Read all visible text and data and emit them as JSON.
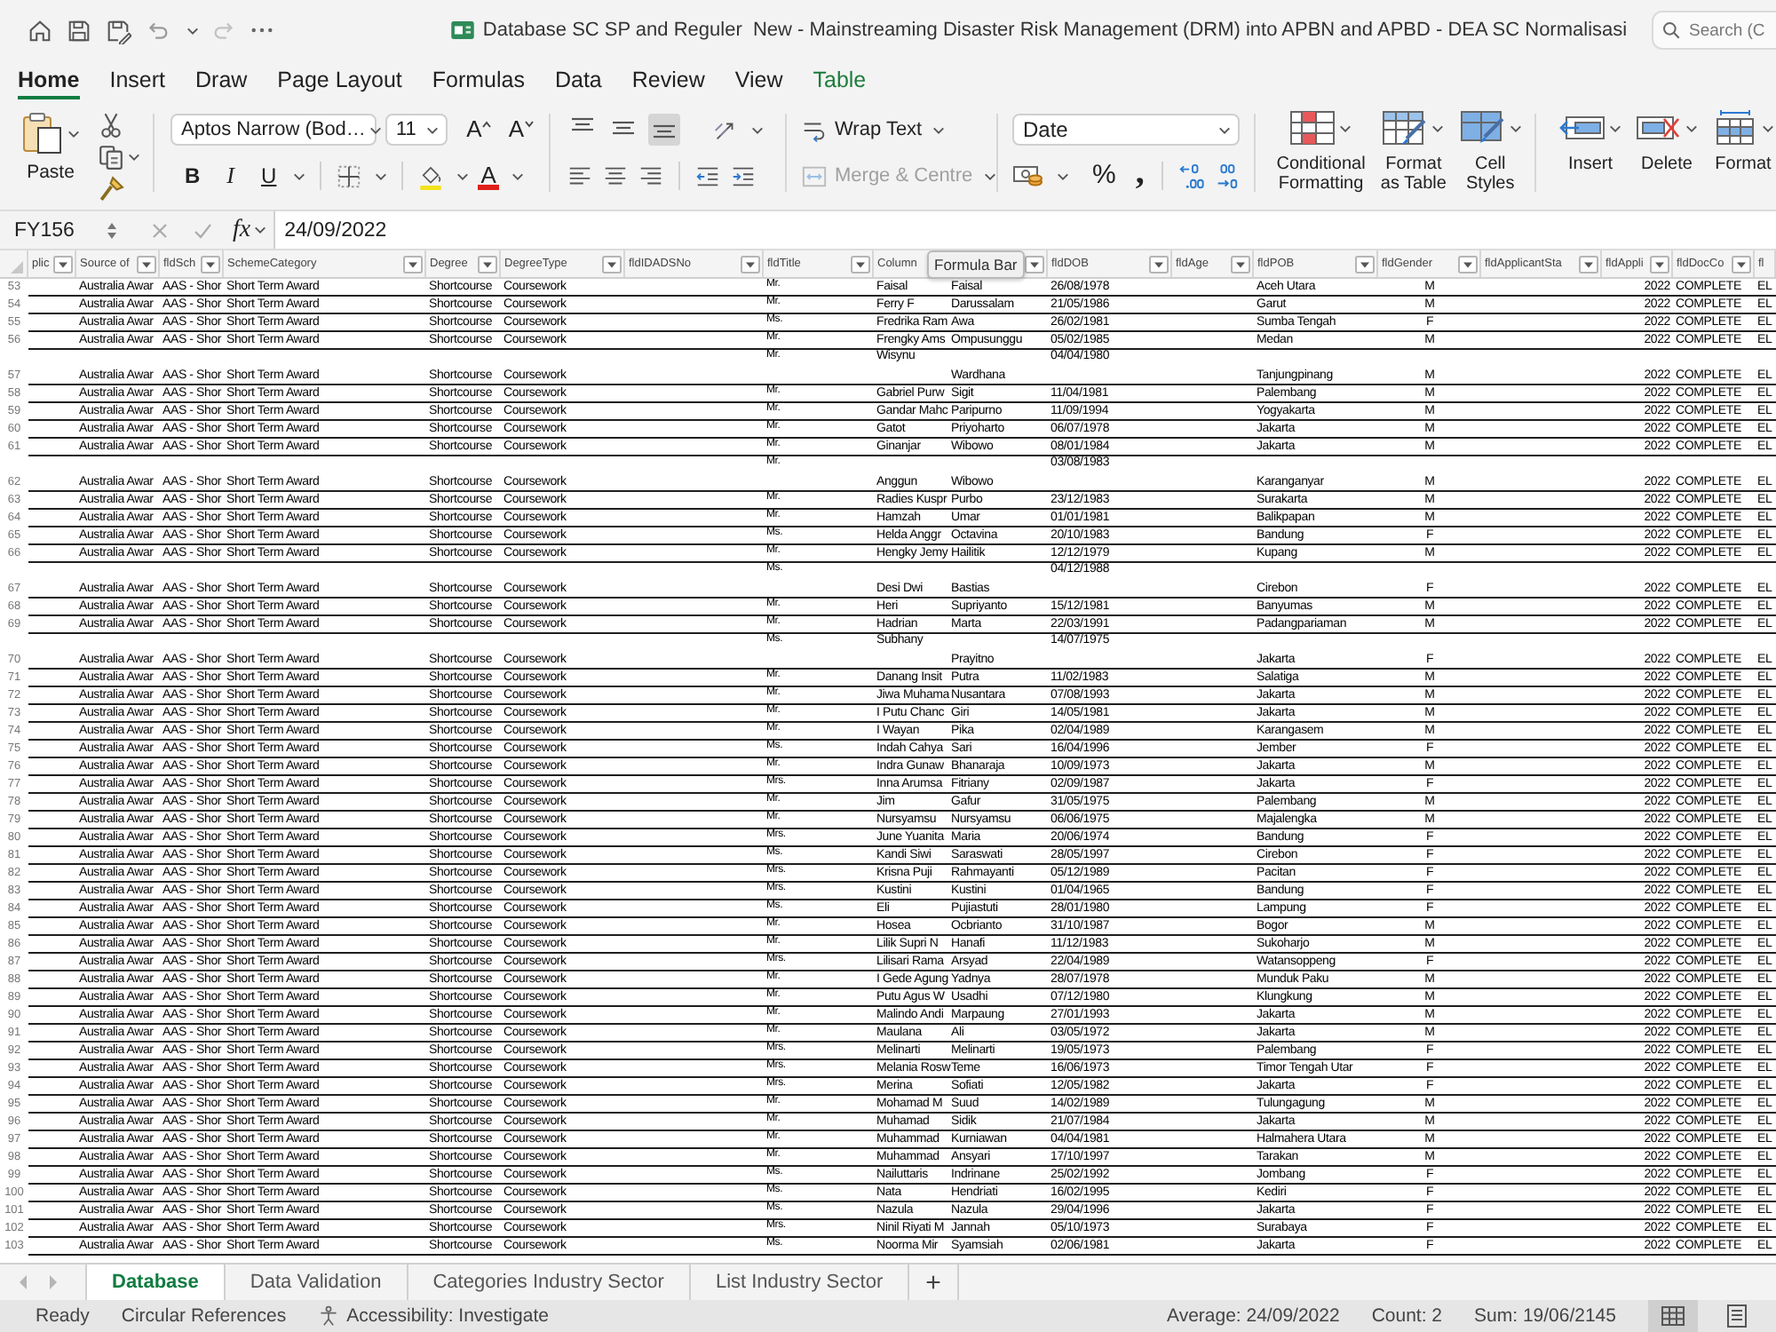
{
  "title_bar": {
    "title": "Database SC SP and Reguler  New - Mainstreaming Disaster Risk Management (DRM) into APBN and APBD - DEA SC Normalisasi",
    "search": {
      "placeholder": "Search (C"
    }
  },
  "ribbon_tabs": [
    {
      "label": "Home",
      "selected": true,
      "contextual": false
    },
    {
      "label": "Insert",
      "selected": false,
      "contextual": false
    },
    {
      "label": "Draw",
      "selected": false,
      "contextual": false
    },
    {
      "label": "Page Layout",
      "selected": false,
      "contextual": false
    },
    {
      "label": "Formulas",
      "selected": false,
      "contextual": false
    },
    {
      "label": "Data",
      "selected": false,
      "contextual": false
    },
    {
      "label": "Review",
      "selected": false,
      "contextual": false
    },
    {
      "label": "View",
      "selected": false,
      "contextual": false
    },
    {
      "label": "Table",
      "selected": false,
      "contextual": true
    }
  ],
  "ribbon": {
    "paste": "Paste",
    "font": {
      "name": "Aptos Narrow (Bod…",
      "size": "11",
      "grow": "A",
      "shrink": "A",
      "bold": "B",
      "italic": "I",
      "underline": "U",
      "font_color": "A"
    },
    "vertical_align": [
      {
        "kind": "top",
        "selected": false
      },
      {
        "kind": "middle",
        "selected": false
      },
      {
        "kind": "bottom",
        "selected": true
      }
    ],
    "wrap_text": "Wrap Text",
    "merge": {
      "label": "Merge & Centre",
      "disabled": true
    },
    "number_format": "Date",
    "percent": "%",
    "comma": ",",
    "styles": [
      "Conditional Formatting",
      "Format as Table",
      "Cell Styles"
    ],
    "cells": [
      "Insert",
      "Delete",
      "Format"
    ]
  },
  "formula_bar": {
    "name_box": "FY156",
    "function_button": "fx",
    "formula": "24/09/2022",
    "tooltip": "Formula Bar"
  },
  "table": {
    "columns": [
      {
        "header": "plic",
        "filter": true
      },
      {
        "header": "Source of",
        "filter": true
      },
      {
        "header": "fldSch",
        "filter": true
      },
      {
        "header": "SchemeCategory",
        "filter": true
      },
      {
        "header": "Degree",
        "filter": true
      },
      {
        "header": "DegreeType",
        "filter": true
      },
      {
        "header": "fldIDADSNo",
        "filter": true
      },
      {
        "header": "fldTitle",
        "filter": true
      },
      {
        "header": "Column",
        "filter": false
      },
      {
        "filter": true
      },
      {
        "header": "fldDOB",
        "filter": true
      },
      {
        "header": "fldAge",
        "filter": true
      },
      {
        "header": "fldPOB",
        "filter": true
      },
      {
        "header": "fldGender",
        "filter": true
      },
      {
        "header": "fldApplicantSta",
        "filter": true
      },
      {
        "header": "fldAppli",
        "filter": true
      },
      {
        "header": "fldDocCo",
        "filter": true
      },
      {
        "header": "fl",
        "filter": false
      }
    ],
    "rows": [
      {
        "number": "53",
        "kind": "single",
        "cells": [
          null,
          "Australia Awar",
          "AAS - Shor",
          "Short Term Award",
          "Shortcourse",
          "Coursework",
          null,
          "Mr.",
          "Faisal",
          "Faisal",
          "26/08/1978",
          null,
          "Aceh Utara",
          "M",
          null,
          "2022",
          "COMPLETE",
          "EL"
        ]
      },
      {
        "number": "54",
        "kind": "single",
        "cells": [
          null,
          "Australia Awar",
          "AAS - Shor",
          "Short Term Award",
          "Shortcourse",
          "Coursework",
          null,
          "Mr.",
          "Ferry F",
          "Darussalam",
          "21/05/1986",
          null,
          "Garut",
          "M",
          null,
          "2022",
          "COMPLETE",
          "EL"
        ]
      },
      {
        "number": "55",
        "kind": "single",
        "cells": [
          null,
          "Australia Awar",
          "AAS - Shor",
          "Short Term Award",
          "Shortcourse",
          "Coursework",
          null,
          "Ms.",
          "Fredrika Ram",
          "Awa",
          "26/02/1981",
          null,
          "Sumba Tengah",
          "F",
          null,
          "2022",
          "COMPLETE",
          "EL"
        ]
      },
      {
        "number": "56",
        "kind": "single",
        "cells": [
          null,
          "Australia Awar",
          "AAS - Shor",
          "Short Term Award",
          "Shortcourse",
          "Coursework",
          null,
          "Mr.",
          "Frengky Ams",
          "Ompusunggu",
          "05/02/1985",
          null,
          "Medan",
          "M",
          null,
          "2022",
          "COMPLETE",
          "EL"
        ]
      },
      {
        "number": "57",
        "kind": "name-top",
        "cells": [
          null,
          "Australia Awar",
          "AAS - Shor",
          "Short Term Award",
          "Shortcourse",
          "Coursework",
          null,
          "Mr.",
          "Wisynu",
          "Wardhana",
          "04/04/1980",
          null,
          "Tanjungpinang",
          "M",
          null,
          "2022",
          "COMPLETE",
          "EL"
        ]
      },
      {
        "number": "58",
        "kind": "single",
        "cells": [
          null,
          "Australia Awar",
          "AAS - Shor",
          "Short Term Award",
          "Shortcourse",
          "Coursework",
          null,
          "Mr.",
          "Gabriel Purw",
          "Sigit",
          "11/04/1981",
          null,
          "Palembang",
          "M",
          null,
          "2022",
          "COMPLETE",
          "EL"
        ]
      },
      {
        "number": "59",
        "kind": "single",
        "cells": [
          null,
          "Australia Awar",
          "AAS - Shor",
          "Short Term Award",
          "Shortcourse",
          "Coursework",
          null,
          "Mr.",
          "Gandar Mahc",
          "Paripurno",
          "11/09/1994",
          null,
          "Yogyakarta",
          "M",
          null,
          "2022",
          "COMPLETE",
          "EL"
        ]
      },
      {
        "number": "60",
        "kind": "single",
        "cells": [
          null,
          "Australia Awar",
          "AAS - Shor",
          "Short Term Award",
          "Shortcourse",
          "Coursework",
          null,
          "Mr.",
          "Gatot",
          "Priyoharto",
          "06/07/1978",
          null,
          "Jakarta",
          "M",
          null,
          "2022",
          "COMPLETE",
          "EL"
        ]
      },
      {
        "number": "61",
        "kind": "single",
        "cells": [
          null,
          "Australia Awar",
          "AAS - Shor",
          "Short Term Award",
          "Shortcourse",
          "Coursework",
          null,
          "Mr.",
          "Ginanjar",
          "Wibowo",
          "08/01/1984",
          null,
          "Jakarta",
          "M",
          null,
          "2022",
          "COMPLETE",
          "EL"
        ]
      },
      {
        "number": "62",
        "kind": "name-bottom",
        "cells": [
          null,
          "Australia Awar",
          "AAS - Shor",
          "Short Term Award",
          "Shortcourse",
          "Coursework",
          null,
          "Mr.",
          "Anggun",
          "Wibowo",
          "03/08/1983",
          null,
          "Karanganyar",
          "M",
          null,
          "2022",
          "COMPLETE",
          "EL"
        ]
      },
      {
        "number": "63",
        "kind": "single",
        "cells": [
          null,
          "Australia Awar",
          "AAS - Shor",
          "Short Term Award",
          "Shortcourse",
          "Coursework",
          null,
          "Mr.",
          "Radies Kuspr",
          "Purbo",
          "23/12/1983",
          null,
          "Surakarta",
          "M",
          null,
          "2022",
          "COMPLETE",
          "EL"
        ]
      },
      {
        "number": "64",
        "kind": "single",
        "cells": [
          null,
          "Australia Awar",
          "AAS - Shor",
          "Short Term Award",
          "Shortcourse",
          "Coursework",
          null,
          "Mr.",
          "Hamzah",
          "Umar",
          "01/01/1981",
          null,
          "Balikpapan",
          "M",
          null,
          "2022",
          "COMPLETE",
          "EL"
        ]
      },
      {
        "number": "65",
        "kind": "single",
        "cells": [
          null,
          "Australia Awar",
          "AAS - Shor",
          "Short Term Award",
          "Shortcourse",
          "Coursework",
          null,
          "Ms.",
          "Helda Anggr",
          "Octavina",
          "20/10/1983",
          null,
          "Bandung",
          "F",
          null,
          "2022",
          "COMPLETE",
          "EL"
        ]
      },
      {
        "number": "66",
        "kind": "single",
        "cells": [
          null,
          "Australia Awar",
          "AAS - Shor",
          "Short Term Award",
          "Shortcourse",
          "Coursework",
          null,
          "Mr.",
          "Hengky Jemy",
          "Hailitik",
          "12/12/1979",
          null,
          "Kupang",
          "M",
          null,
          "2022",
          "COMPLETE",
          "EL"
        ]
      },
      {
        "number": "67",
        "kind": "name-bottom",
        "cells": [
          null,
          "Australia Awar",
          "AAS - Shor",
          "Short Term Award",
          "Shortcourse",
          "Coursework",
          null,
          "Ms.",
          "Desi Dwi",
          "Bastias",
          "04/12/1988",
          null,
          "Cirebon",
          "F",
          null,
          "2022",
          "COMPLETE",
          "EL"
        ]
      },
      {
        "number": "68",
        "kind": "single",
        "cells": [
          null,
          "Australia Awar",
          "AAS - Shor",
          "Short Term Award",
          "Shortcourse",
          "Coursework",
          null,
          "Mr.",
          "Heri",
          "Supriyanto",
          "15/12/1981",
          null,
          "Banyumas",
          "M",
          null,
          "2022",
          "COMPLETE",
          "EL"
        ]
      },
      {
        "number": "69",
        "kind": "single",
        "cells": [
          null,
          "Australia Awar",
          "AAS - Shor",
          "Short Term Award",
          "Shortcourse",
          "Coursework",
          null,
          "Mr.",
          "Hadrian",
          "Marta",
          "22/03/1991",
          null,
          "Padangpariaman",
          "M",
          null,
          "2022",
          "COMPLETE",
          "EL"
        ]
      },
      {
        "number": "70",
        "kind": "name-top",
        "cells": [
          null,
          "Australia Awar",
          "AAS - Shor",
          "Short Term Award",
          "Shortcourse",
          "Coursework",
          null,
          "Ms.",
          "Subhany",
          "Prayitno",
          "14/07/1975",
          null,
          "Jakarta",
          "F",
          null,
          "2022",
          "COMPLETE",
          "EL"
        ]
      },
      {
        "number": "71",
        "kind": "single",
        "cells": [
          null,
          "Australia Awar",
          "AAS - Shor",
          "Short Term Award",
          "Shortcourse",
          "Coursework",
          null,
          "Mr.",
          "Danang Insit",
          "Putra",
          "11/02/1983",
          null,
          "Salatiga",
          "M",
          null,
          "2022",
          "COMPLETE",
          "EL"
        ]
      },
      {
        "number": "72",
        "kind": "single",
        "cells": [
          null,
          "Australia Awar",
          "AAS - Shor",
          "Short Term Award",
          "Shortcourse",
          "Coursework",
          null,
          "Mr.",
          "Jiwa Muhama",
          "Nusantara",
          "07/08/1993",
          null,
          "Jakarta",
          "M",
          null,
          "2022",
          "COMPLETE",
          "EL"
        ]
      },
      {
        "number": "73",
        "kind": "single",
        "cells": [
          null,
          "Australia Awar",
          "AAS - Shor",
          "Short Term Award",
          "Shortcourse",
          "Coursework",
          null,
          "Mr.",
          "I Putu Chanc",
          "Giri",
          "14/05/1981",
          null,
          "Jakarta",
          "M",
          null,
          "2022",
          "COMPLETE",
          "EL"
        ]
      },
      {
        "number": "74",
        "kind": "single",
        "cells": [
          null,
          "Australia Awar",
          "AAS - Shor",
          "Short Term Award",
          "Shortcourse",
          "Coursework",
          null,
          "Mr.",
          "I Wayan",
          "Pika",
          "02/04/1989",
          null,
          "Karangasem",
          "M",
          null,
          "2022",
          "COMPLETE",
          "EL"
        ]
      },
      {
        "number": "75",
        "kind": "single",
        "cells": [
          null,
          "Australia Awar",
          "AAS - Shor",
          "Short Term Award",
          "Shortcourse",
          "Coursework",
          null,
          "Ms.",
          "Indah Cahya",
          "Sari",
          "16/04/1996",
          null,
          "Jember",
          "F",
          null,
          "2022",
          "COMPLETE",
          "EL"
        ]
      },
      {
        "number": "76",
        "kind": "single",
        "cells": [
          null,
          "Australia Awar",
          "AAS - Shor",
          "Short Term Award",
          "Shortcourse",
          "Coursework",
          null,
          "Mr.",
          "Indra Gunaw",
          "Bhanaraja",
          "10/09/1973",
          null,
          "Jakarta",
          "M",
          null,
          "2022",
          "COMPLETE",
          "EL"
        ]
      },
      {
        "number": "77",
        "kind": "single",
        "cells": [
          null,
          "Australia Awar",
          "AAS - Shor",
          "Short Term Award",
          "Shortcourse",
          "Coursework",
          null,
          "Mrs.",
          "Inna Arumsa",
          "Fitriany",
          "02/09/1987",
          null,
          "Jakarta",
          "F",
          null,
          "2022",
          "COMPLETE",
          "EL"
        ]
      },
      {
        "number": "78",
        "kind": "single",
        "cells": [
          null,
          "Australia Awar",
          "AAS - Shor",
          "Short Term Award",
          "Shortcourse",
          "Coursework",
          null,
          "Mr.",
          "Jim",
          "Gafur",
          "31/05/1975",
          null,
          "Palembang",
          "M",
          null,
          "2022",
          "COMPLETE",
          "EL"
        ]
      },
      {
        "number": "79",
        "kind": "single",
        "cells": [
          null,
          "Australia Awar",
          "AAS - Shor",
          "Short Term Award",
          "Shortcourse",
          "Coursework",
          null,
          "Mr.",
          "Nursyamsu",
          "Nursyamsu",
          "06/06/1975",
          null,
          "Majalengka",
          "M",
          null,
          "2022",
          "COMPLETE",
          "EL"
        ]
      },
      {
        "number": "80",
        "kind": "single",
        "cells": [
          null,
          "Australia Awar",
          "AAS - Shor",
          "Short Term Award",
          "Shortcourse",
          "Coursework",
          null,
          "Mrs.",
          "June Yuanita",
          "Maria",
          "20/06/1974",
          null,
          "Bandung",
          "F",
          null,
          "2022",
          "COMPLETE",
          "EL"
        ]
      },
      {
        "number": "81",
        "kind": "single",
        "cells": [
          null,
          "Australia Awar",
          "AAS - Shor",
          "Short Term Award",
          "Shortcourse",
          "Coursework",
          null,
          "Ms.",
          "Kandi Siwi",
          "Saraswati",
          "28/05/1997",
          null,
          "Cirebon",
          "F",
          null,
          "2022",
          "COMPLETE",
          "EL"
        ]
      },
      {
        "number": "82",
        "kind": "single",
        "cells": [
          null,
          "Australia Awar",
          "AAS - Shor",
          "Short Term Award",
          "Shortcourse",
          "Coursework",
          null,
          "Mrs.",
          "Krisna Puji",
          "Rahmayanti",
          "05/12/1989",
          null,
          "Pacitan",
          "F",
          null,
          "2022",
          "COMPLETE",
          "EL"
        ]
      },
      {
        "number": "83",
        "kind": "single",
        "cells": [
          null,
          "Australia Awar",
          "AAS - Shor",
          "Short Term Award",
          "Shortcourse",
          "Coursework",
          null,
          "Mrs.",
          "Kustini",
          "Kustini",
          "01/04/1965",
          null,
          "Bandung",
          "F",
          null,
          "2022",
          "COMPLETE",
          "EL"
        ]
      },
      {
        "number": "84",
        "kind": "single",
        "cells": [
          null,
          "Australia Awar",
          "AAS - Shor",
          "Short Term Award",
          "Shortcourse",
          "Coursework",
          null,
          "Ms.",
          "Eli",
          "Pujiastuti",
          "28/01/1980",
          null,
          "Lampung",
          "F",
          null,
          "2022",
          "COMPLETE",
          "EL"
        ]
      },
      {
        "number": "85",
        "kind": "single",
        "cells": [
          null,
          "Australia Awar",
          "AAS - Shor",
          "Short Term Award",
          "Shortcourse",
          "Coursework",
          null,
          "Mr.",
          "Hosea",
          "Ocbrianto",
          "31/10/1987",
          null,
          "Bogor",
          "M",
          null,
          "2022",
          "COMPLETE",
          "EL"
        ]
      },
      {
        "number": "86",
        "kind": "single",
        "cells": [
          null,
          "Australia Awar",
          "AAS - Shor",
          "Short Term Award",
          "Shortcourse",
          "Coursework",
          null,
          "Mr.",
          "Lilik Supri N",
          "Hanafi",
          "11/12/1983",
          null,
          "Sukoharjo",
          "M",
          null,
          "2022",
          "COMPLETE",
          "EL"
        ]
      },
      {
        "number": "87",
        "kind": "single",
        "cells": [
          null,
          "Australia Awar",
          "AAS - Shor",
          "Short Term Award",
          "Shortcourse",
          "Coursework",
          null,
          "Mrs.",
          "Lilisari Rama",
          "Arsyad",
          "22/04/1989",
          null,
          "Watansoppeng",
          "F",
          null,
          "2022",
          "COMPLETE",
          "EL"
        ]
      },
      {
        "number": "88",
        "kind": "single",
        "cells": [
          null,
          "Australia Awar",
          "AAS - Shor",
          "Short Term Award",
          "Shortcourse",
          "Coursework",
          null,
          "Mr.",
          "I Gede Agung",
          "Yadnya",
          "28/07/1978",
          null,
          "Munduk Paku",
          "M",
          null,
          "2022",
          "COMPLETE",
          "EL"
        ]
      },
      {
        "number": "89",
        "kind": "single",
        "cells": [
          null,
          "Australia Awar",
          "AAS - Shor",
          "Short Term Award",
          "Shortcourse",
          "Coursework",
          null,
          "Mr.",
          "Putu Agus W",
          "Usadhi",
          "07/12/1980",
          null,
          "Klungkung",
          "M",
          null,
          "2022",
          "COMPLETE",
          "EL"
        ]
      },
      {
        "number": "90",
        "kind": "single",
        "cells": [
          null,
          "Australia Awar",
          "AAS - Shor",
          "Short Term Award",
          "Shortcourse",
          "Coursework",
          null,
          "Mr.",
          "Malindo Andi",
          "Marpaung",
          "27/01/1993",
          null,
          "Jakarta",
          "M",
          null,
          "2022",
          "COMPLETE",
          "EL"
        ]
      },
      {
        "number": "91",
        "kind": "single",
        "cells": [
          null,
          "Australia Awar",
          "AAS - Shor",
          "Short Term Award",
          "Shortcourse",
          "Coursework",
          null,
          "Mr.",
          "Maulana",
          "Ali",
          "03/05/1972",
          null,
          "Jakarta",
          "M",
          null,
          "2022",
          "COMPLETE",
          "EL"
        ]
      },
      {
        "number": "92",
        "kind": "single",
        "cells": [
          null,
          "Australia Awar",
          "AAS - Shor",
          "Short Term Award",
          "Shortcourse",
          "Coursework",
          null,
          "Mrs.",
          "Melinarti",
          "Melinarti",
          "19/05/1973",
          null,
          "Palembang",
          "F",
          null,
          "2022",
          "COMPLETE",
          "EL"
        ]
      },
      {
        "number": "93",
        "kind": "single",
        "cells": [
          null,
          "Australia Awar",
          "AAS - Shor",
          "Short Term Award",
          "Shortcourse",
          "Coursework",
          null,
          "Mrs.",
          "Melania Rosw",
          "Teme",
          "16/06/1973",
          null,
          "Timor Tengah Utar",
          "F",
          null,
          "2022",
          "COMPLETE",
          "EL"
        ]
      },
      {
        "number": "94",
        "kind": "single",
        "cells": [
          null,
          "Australia Awar",
          "AAS - Shor",
          "Short Term Award",
          "Shortcourse",
          "Coursework",
          null,
          "Mrs.",
          "Merina",
          "Sofiati",
          "12/05/1982",
          null,
          "Jakarta",
          "F",
          null,
          "2022",
          "COMPLETE",
          "EL"
        ]
      },
      {
        "number": "95",
        "kind": "single",
        "cells": [
          null,
          "Australia Awar",
          "AAS - Shor",
          "Short Term Award",
          "Shortcourse",
          "Coursework",
          null,
          "Mr.",
          "Mohamad M",
          "Suud",
          "14/02/1989",
          null,
          "Tulungagung",
          "M",
          null,
          "2022",
          "COMPLETE",
          "EL"
        ]
      },
      {
        "number": "96",
        "kind": "single",
        "cells": [
          null,
          "Australia Awar",
          "AAS - Shor",
          "Short Term Award",
          "Shortcourse",
          "Coursework",
          null,
          "Mr.",
          "Muhamad",
          "Sidik",
          "21/07/1984",
          null,
          "Jakarta",
          "M",
          null,
          "2022",
          "COMPLETE",
          "EL"
        ]
      },
      {
        "number": "97",
        "kind": "single",
        "cells": [
          null,
          "Australia Awar",
          "AAS - Shor",
          "Short Term Award",
          "Shortcourse",
          "Coursework",
          null,
          "Mr.",
          "Muhammad",
          "Kurniawan",
          "04/04/1981",
          null,
          "Halmahera Utara",
          "M",
          null,
          "2022",
          "COMPLETE",
          "EL"
        ]
      },
      {
        "number": "98",
        "kind": "single",
        "cells": [
          null,
          "Australia Awar",
          "AAS - Shor",
          "Short Term Award",
          "Shortcourse",
          "Coursework",
          null,
          "Mr.",
          "Muhammad",
          "Ansyari",
          "17/10/1997",
          null,
          "Tarakan",
          "M",
          null,
          "2022",
          "COMPLETE",
          "EL"
        ]
      },
      {
        "number": "99",
        "kind": "single",
        "cells": [
          null,
          "Australia Awar",
          "AAS - Shor",
          "Short Term Award",
          "Shortcourse",
          "Coursework",
          null,
          "Ms.",
          "Nailuttaris",
          "Indrinane",
          "25/02/1992",
          null,
          "Jombang",
          "F",
          null,
          "2022",
          "COMPLETE",
          "EL"
        ]
      },
      {
        "number": "100",
        "kind": "single",
        "cells": [
          null,
          "Australia Awar",
          "AAS - Shor",
          "Short Term Award",
          "Shortcourse",
          "Coursework",
          null,
          "Ms.",
          "Nata",
          "Hendriati",
          "16/02/1995",
          null,
          "Kediri",
          "F",
          null,
          "2022",
          "COMPLETE",
          "EL"
        ]
      },
      {
        "number": "101",
        "kind": "single",
        "cells": [
          null,
          "Australia Awar",
          "AAS - Shor",
          "Short Term Award",
          "Shortcourse",
          "Coursework",
          null,
          "Ms.",
          "Nazula",
          "Nazula",
          "29/04/1996",
          null,
          "Jakarta",
          "F",
          null,
          "2022",
          "COMPLETE",
          "EL"
        ]
      },
      {
        "number": "102",
        "kind": "single",
        "cells": [
          null,
          "Australia Awar",
          "AAS - Shor",
          "Short Term Award",
          "Shortcourse",
          "Coursework",
          null,
          "Mrs.",
          "Ninil Riyati M",
          "Jannah",
          "05/10/1973",
          null,
          "Surabaya",
          "F",
          null,
          "2022",
          "COMPLETE",
          "EL"
        ]
      },
      {
        "number": "103",
        "kind": "single",
        "cells": [
          null,
          "Australia Awar",
          "AAS - Shor",
          "Short Term Award",
          "Shortcourse",
          "Coursework",
          null,
          "Ms.",
          "Noorma Mir",
          "Syamsiah",
          "02/06/1981",
          null,
          "Jakarta",
          "F",
          null,
          "2022",
          "COMPLETE",
          "EL"
        ]
      }
    ]
  },
  "sheet_tabs": [
    {
      "label": "Database",
      "selected": true
    },
    {
      "label": "Data Validation",
      "selected": false
    },
    {
      "label": "Categories Industry Sector",
      "selected": false
    },
    {
      "label": "List Industry Sector",
      "selected": false
    }
  ],
  "add_sheet": "+",
  "status_bar": {
    "ready": "Ready",
    "circular": "Circular References",
    "accessibility": "Accessibility: Investigate",
    "average": "Average: 24/09/2022",
    "count": "Count: 2",
    "sum": "Sum: 19/06/2145",
    "views": [
      {
        "kind": "normal",
        "selected": true
      },
      {
        "kind": "page",
        "selected": false
      }
    ]
  }
}
